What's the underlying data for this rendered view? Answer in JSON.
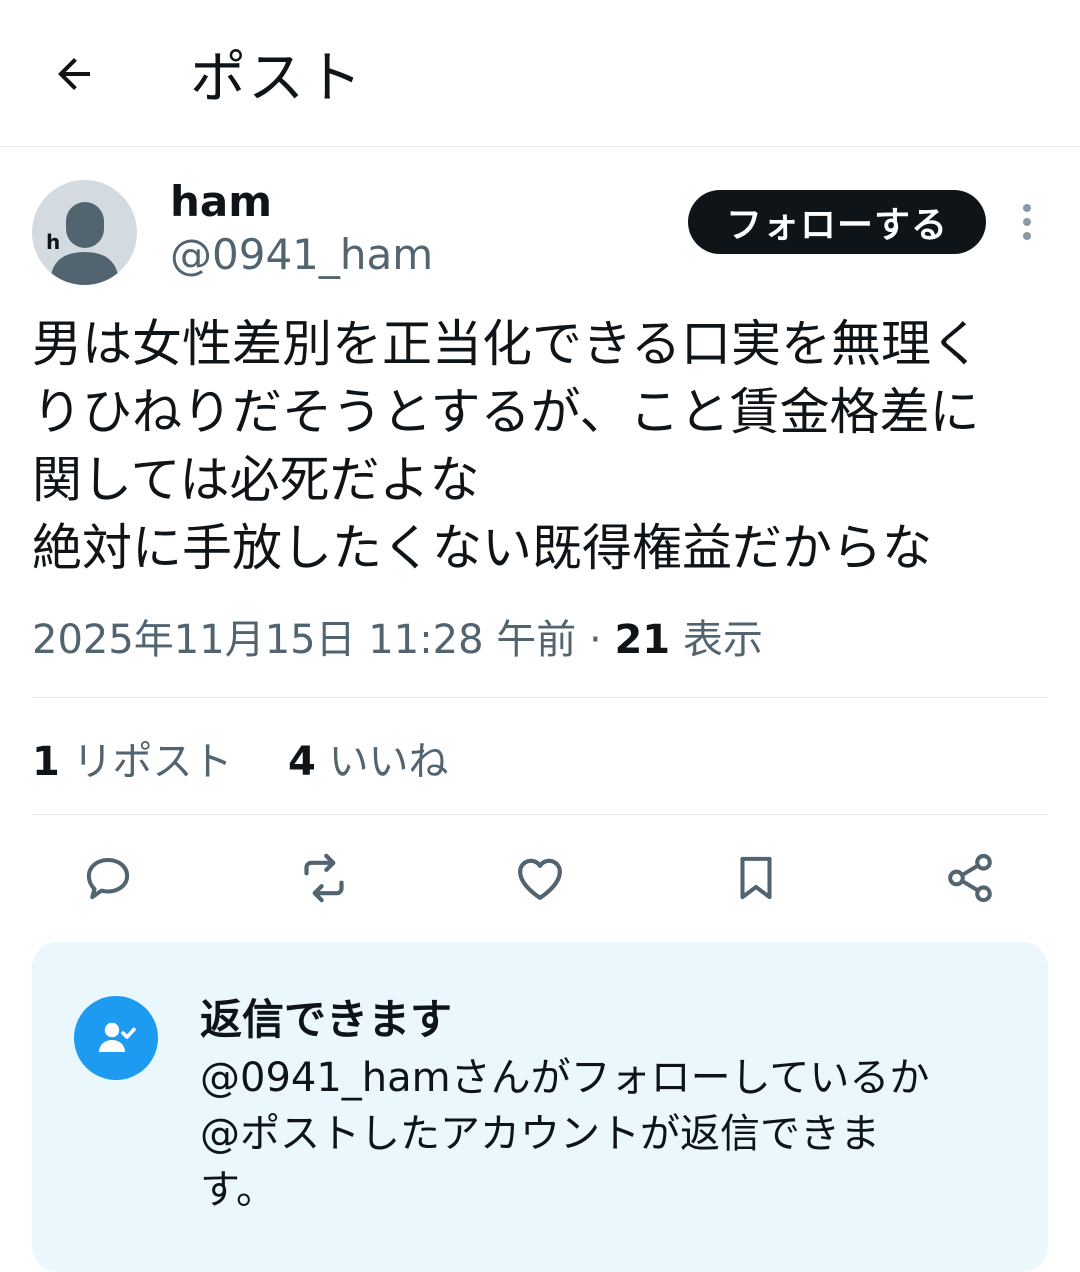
{
  "header": {
    "title": "ポスト"
  },
  "author": {
    "avatar_letter": "h",
    "display_name": "ham",
    "handle": "@0941_ham",
    "follow_label": "フォローする"
  },
  "post": {
    "lines": [
      "男は女性差別を正当化できる口実を無理く",
      "りひねりだそうとするが、こと賃金格差に",
      "関しては必死だよな",
      "絶対に手放したくない既得権益だからな"
    ],
    "timestamp": "2025年11月15日 11:28 午前",
    "separator": " · ",
    "views_count": "21",
    "views_label": "表示"
  },
  "stats": {
    "reposts_count": "1",
    "reposts_label": "リポスト",
    "likes_count": "4",
    "likes_label": "いいね"
  },
  "actions": [
    "reply-icon",
    "repost-icon",
    "like-icon",
    "bookmark-icon",
    "share-icon"
  ],
  "reply_restriction": {
    "title": "返信できます",
    "body_lines": [
      "@0941_hamさんがフォローしているか",
      "@ポストしたアカウントが返信できま",
      "す。"
    ]
  },
  "colors": {
    "text": "#0f1419",
    "secondary": "#536471",
    "accent": "#1d9bf0",
    "card_bg": "#eaf7fd"
  }
}
